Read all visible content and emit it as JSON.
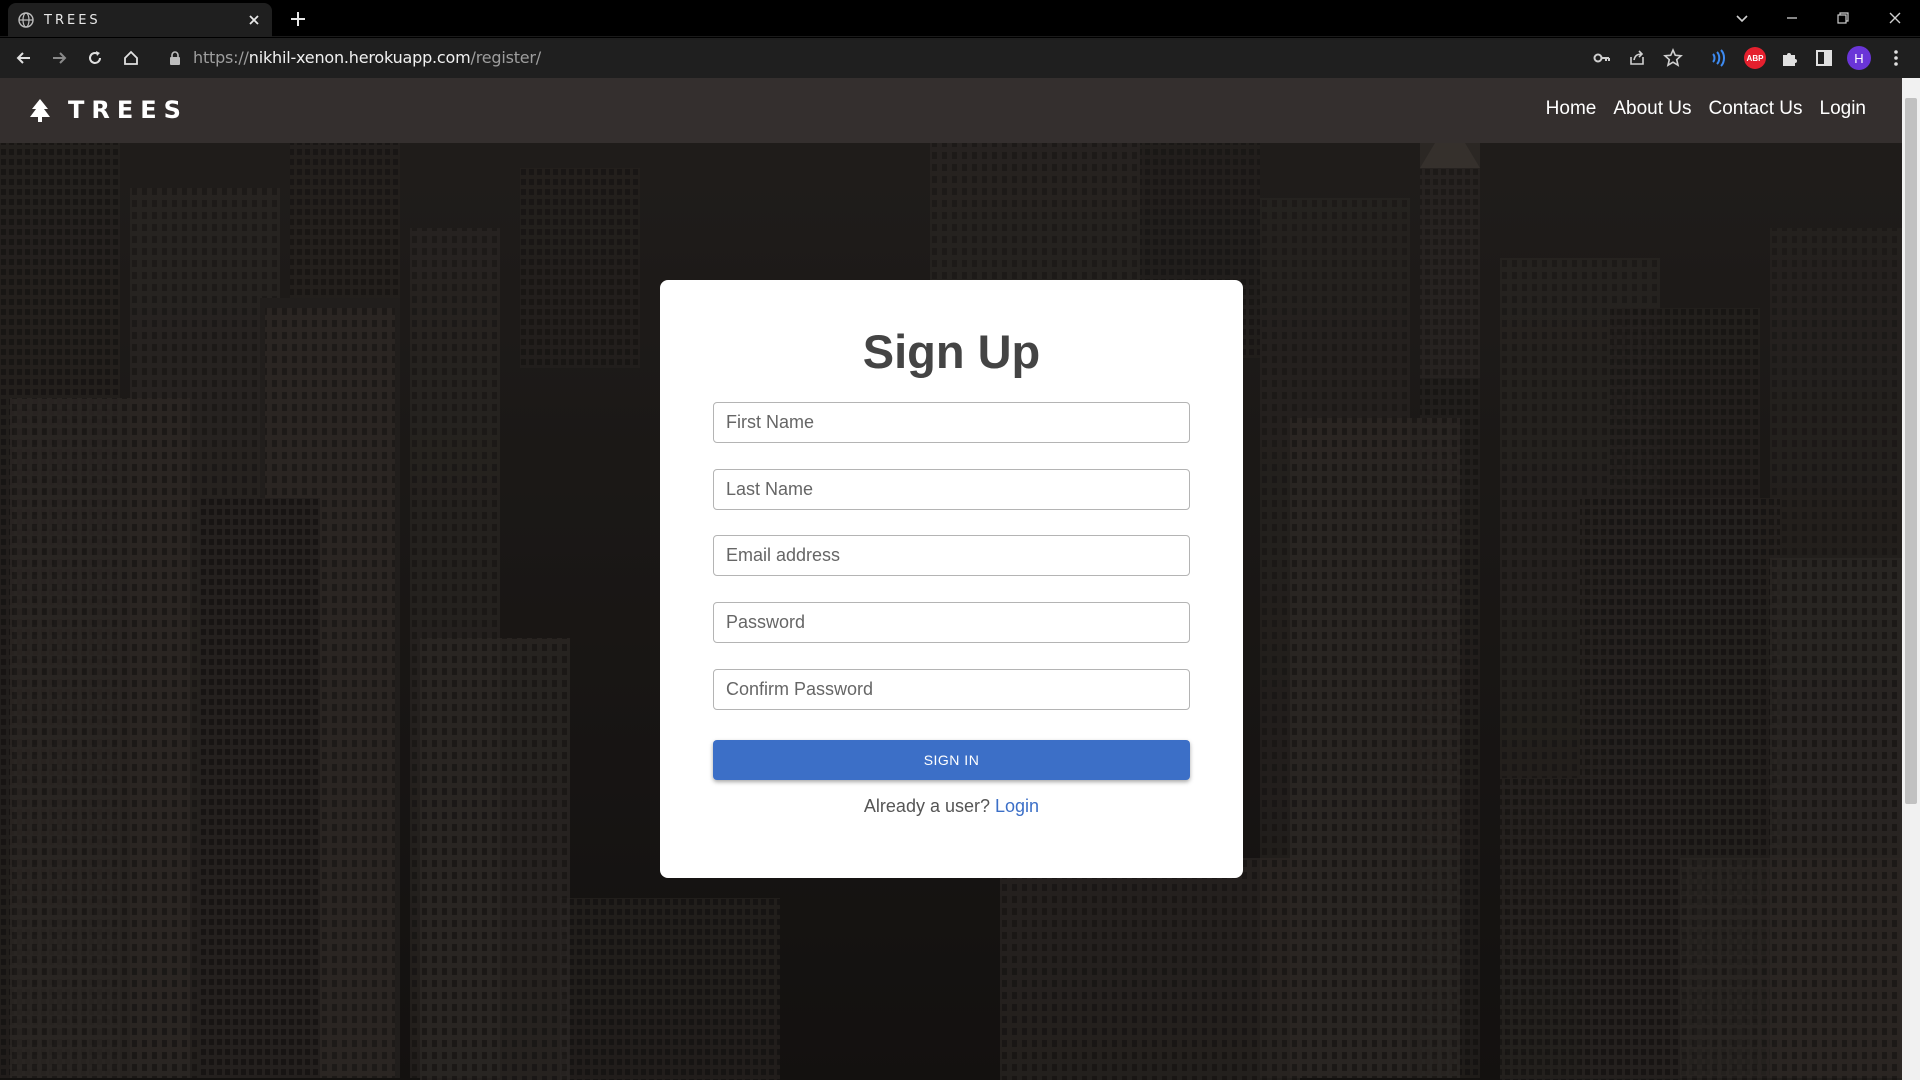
{
  "browser": {
    "tab_title": "TREES",
    "url_scheme": "https://",
    "url_host": "nikhil-xenon.herokuapp.com",
    "url_path": "/register/"
  },
  "site": {
    "brand": "TREES",
    "nav": [
      "Home",
      "About Us",
      "Contact Us",
      "Login"
    ]
  },
  "form": {
    "title": "Sign Up",
    "fields": [
      {
        "placeholder": "First Name"
      },
      {
        "placeholder": "Last Name"
      },
      {
        "placeholder": "Email address"
      },
      {
        "placeholder": "Password"
      },
      {
        "placeholder": "Confirm Password"
      }
    ],
    "submit_label": "SIGN IN",
    "already_text": "Already a user?",
    "login_link": "Login"
  },
  "icons": {
    "profile_initial": "H",
    "abp_label": "ABP"
  },
  "colors": {
    "navbar": "#342f2e",
    "button": "#3c6fc7",
    "link": "#3c6fc7"
  }
}
